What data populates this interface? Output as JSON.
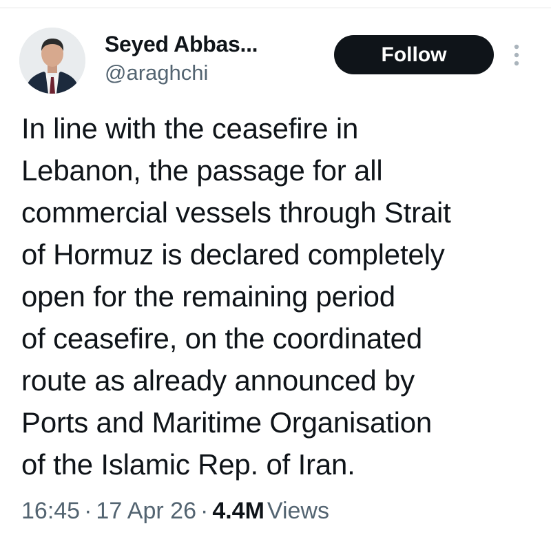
{
  "author": {
    "display_name": "Seyed Abbas...",
    "handle": "@araghchi"
  },
  "follow_button": {
    "label": "Follow"
  },
  "more_button": {
    "icon": "more-vertical-icon"
  },
  "tweet": {
    "lines": [
      "In line with the ceasefire in",
      "Lebanon, the passage for all",
      "commercial vessels through Strait",
      "of Hormuz is declared completely",
      "open for the remaining period",
      "of ceasefire, on the coordinated",
      "route as already announced by",
      "Ports and Maritime Organisation",
      "of the Islamic Rep. of Iran."
    ]
  },
  "meta": {
    "time": "16:45",
    "separator": "·",
    "date": "17 Apr 26",
    "views_count": "4.4M",
    "views_label": "Views"
  },
  "colors": {
    "text_primary": "#0f1419",
    "text_secondary": "#536471",
    "follow_button_bg": "#0f1419",
    "follow_button_text": "#ffffff"
  }
}
